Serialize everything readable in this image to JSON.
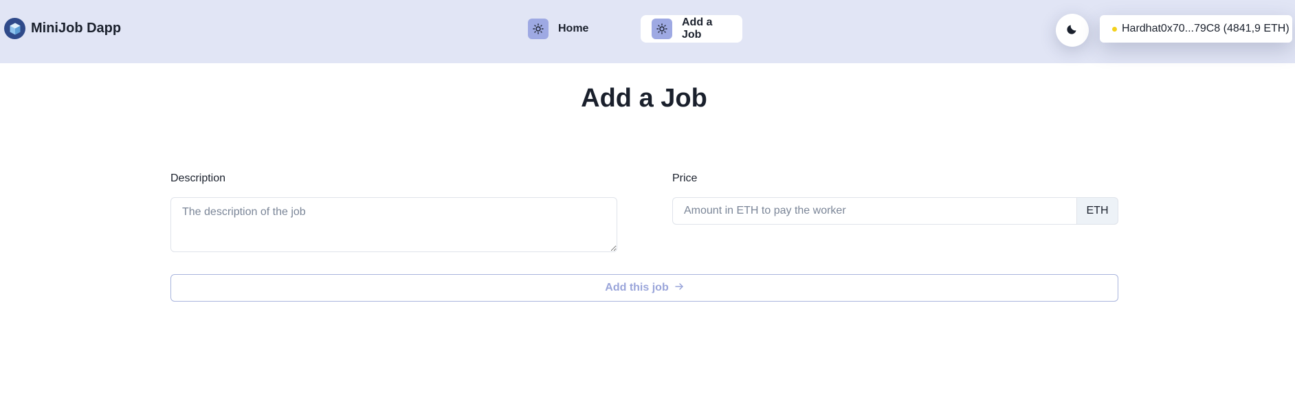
{
  "header": {
    "app_name": "MiniJob Dapp",
    "logo_icon": "cube-logo-icon",
    "nav": [
      {
        "label": "Home",
        "icon": "sun-icon"
      },
      {
        "label": "Add a Job",
        "icon": "sun-icon",
        "active": true
      }
    ],
    "theme_toggle_icon": "moon-icon",
    "account": {
      "label": "Hardhat0x70...79C8 (4841,9 ETH)",
      "status_color": "#f3d11c"
    }
  },
  "main": {
    "title": "Add a Job",
    "description": {
      "label": "Description",
      "placeholder": "The description of the job",
      "value": ""
    },
    "price": {
      "label": "Price",
      "placeholder": "Amount in ETH to pay the worker",
      "value": "",
      "addon": "ETH"
    },
    "submit": {
      "label": "Add this job",
      "icon": "arrow-right-icon"
    }
  },
  "colors": {
    "header_bg": "#e1e5f5",
    "nav_icon_bg": "#9ea9e3",
    "accent_text": "#9aa5da",
    "text": "#1a202c"
  }
}
